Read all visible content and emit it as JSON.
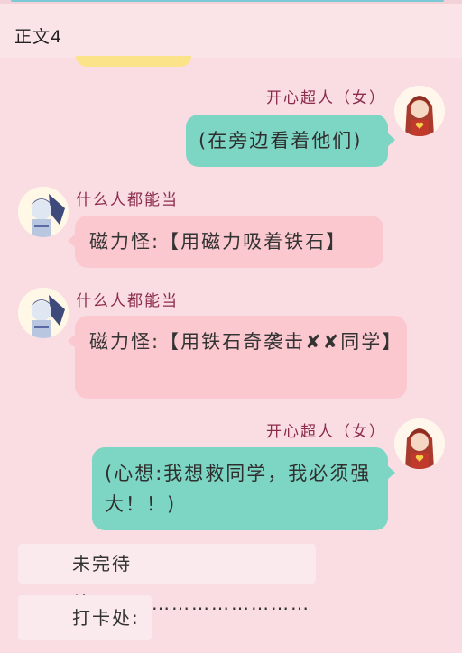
{
  "header": {
    "title": "正文4"
  },
  "messages": [
    {
      "sender": "开心超人（女）",
      "text": "(在旁边看着他们)",
      "side": "right",
      "avatar_icon": "girl-hero-avatar"
    },
    {
      "sender": "什么人都能当",
      "text": "磁力怪:【用磁力吸着铁石】",
      "side": "left",
      "avatar_icon": "blue-monster-avatar"
    },
    {
      "sender": "什么人都能当",
      "text": "磁力怪:【用铁石奇袭击✘✘同学】",
      "side": "left",
      "avatar_icon": "blue-monster-avatar"
    },
    {
      "sender": "开心超人（女）",
      "text": "(心想:我想救同学，我必须强大！！)",
      "side": "right",
      "avatar_icon": "girl-hero-avatar"
    }
  ],
  "footer": {
    "to_be_continued": "未完待续……………………………",
    "checkin": "打卡处:"
  },
  "colors": {
    "teal_bubble": "#7dd5c4",
    "pink_bubble": "#fbc8cf",
    "background": "#f9dde2",
    "name_color": "#8c2b4a"
  }
}
